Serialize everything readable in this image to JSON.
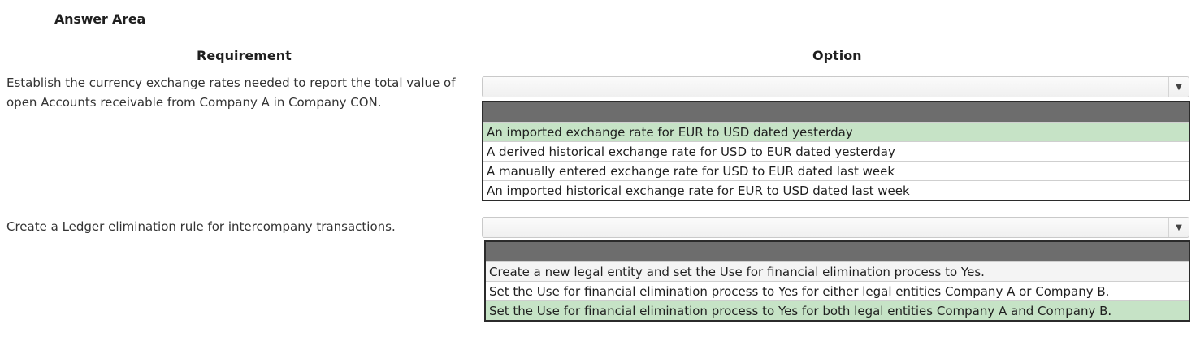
{
  "answer_area": {
    "title": "Answer Area"
  },
  "headers": {
    "requirement": "Requirement",
    "option": "Option"
  },
  "rows": [
    {
      "requirement": "Establish the currency exchange rates needed to report the total value of open Accounts receivable from Company A in Company CON.",
      "options": [
        "An imported exchange rate for EUR to USD dated yesterday",
        "A derived historical exchange rate for USD to EUR dated yesterday",
        "A manually entered exchange rate for USD to EUR dated last week",
        "An imported historical exchange rate for EUR to USD dated last week"
      ],
      "selected_index": 0
    },
    {
      "requirement": "Create a Ledger elimination rule for intercompany transactions.",
      "options": [
        "Create a new legal entity and set the Use for financial elimination process to Yes.",
        "Set the Use for financial elimination process to Yes for either legal entities Company A or Company B.",
        "Set the Use for financial elimination process to Yes for both legal entities Company A and Company B."
      ],
      "selected_index": 2
    }
  ],
  "colors": {
    "selected_highlight": "#c6e3c6",
    "list_header": "#6d6d6d",
    "list_border": "#2b2b2b"
  },
  "icons": {
    "dropdown_arrow": "chevron-down-icon"
  }
}
